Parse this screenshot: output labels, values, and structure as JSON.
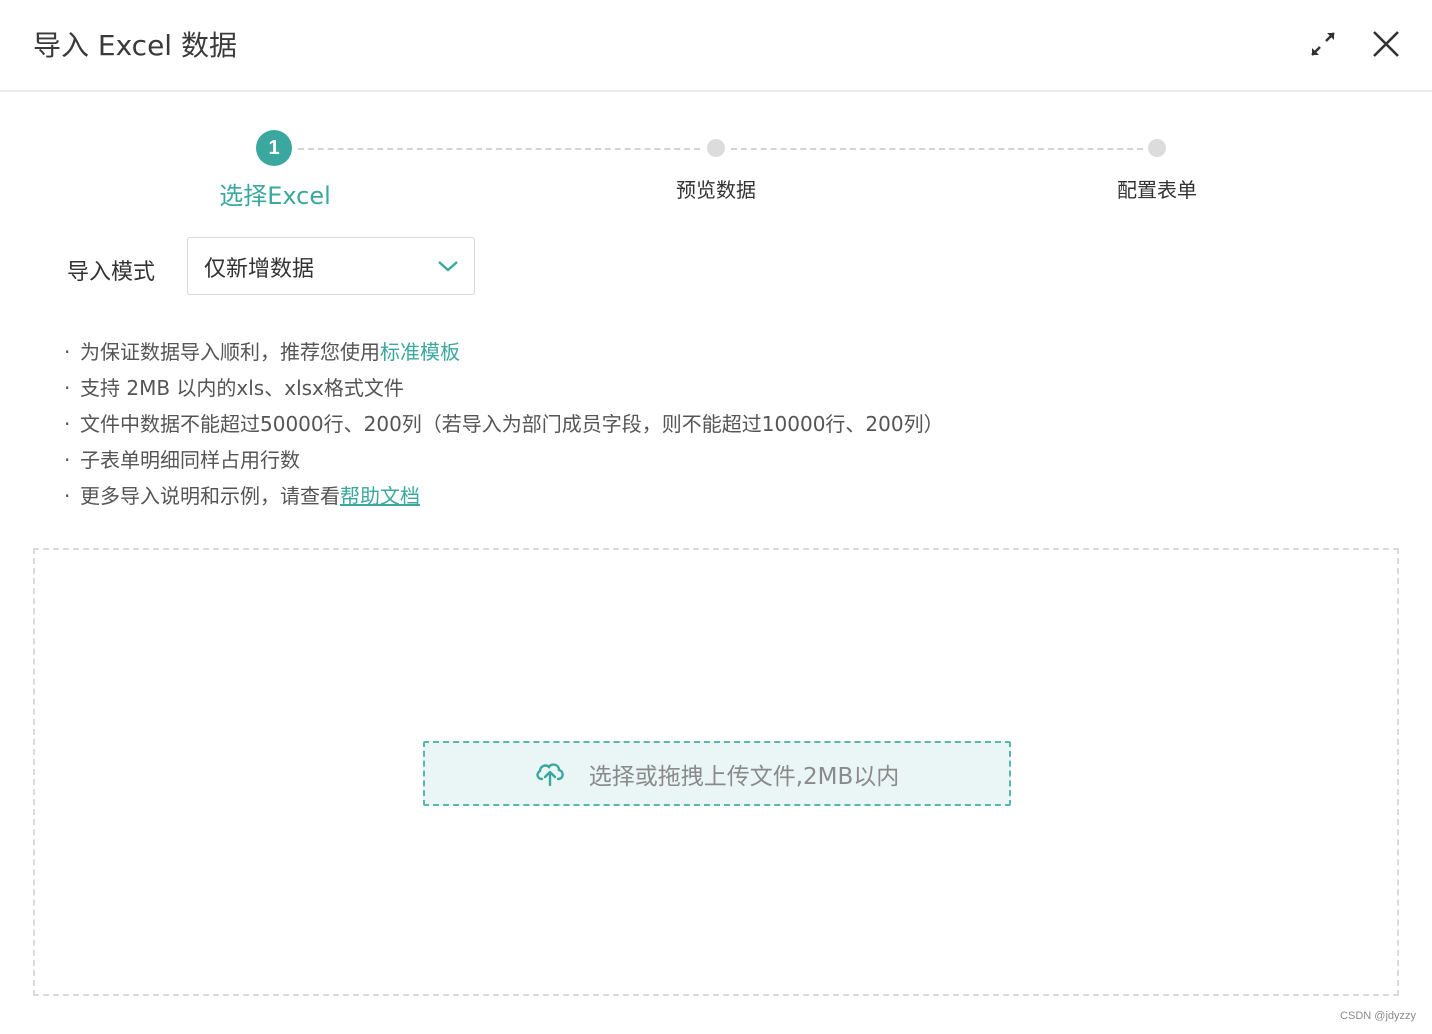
{
  "header": {
    "title": "导入 Excel 数据",
    "expand_icon": "expand-arrows-icon",
    "close_icon": "close-icon"
  },
  "steps": {
    "items": [
      {
        "index": "1",
        "label": "选择Excel",
        "state": "active"
      },
      {
        "index": "2",
        "label": "预览数据",
        "state": "pending"
      },
      {
        "index": "3",
        "label": "配置表单",
        "state": "pending"
      }
    ]
  },
  "import_mode": {
    "label": "导入模式",
    "selected": "仅新增数据"
  },
  "tips": {
    "bullet": "·",
    "line1_text": "为保证数据导入顺利，推荐您使用",
    "line1_link": "标准模板",
    "line2_text": "支持 2MB 以内的xls、xlsx格式文件",
    "line3_text": "文件中数据不能超过50000行、200列（若导入为部门成员字段，则不能超过10000行、200列）",
    "line4_text": "子表单明细同样占用行数",
    "line5_text": "更多导入说明和示例，请查看",
    "line5_link": "帮助文档"
  },
  "upload": {
    "label": "选择或拖拽上传文件,2MB以内",
    "icon": "cloud-upload-icon"
  },
  "watermark": "CSDN @jdyzzy",
  "colors": {
    "accent": "#3aa89e",
    "upload_bg": "#eaf6f5",
    "upload_border": "#58b8ae",
    "inactive_dot": "#dcdcdc"
  }
}
